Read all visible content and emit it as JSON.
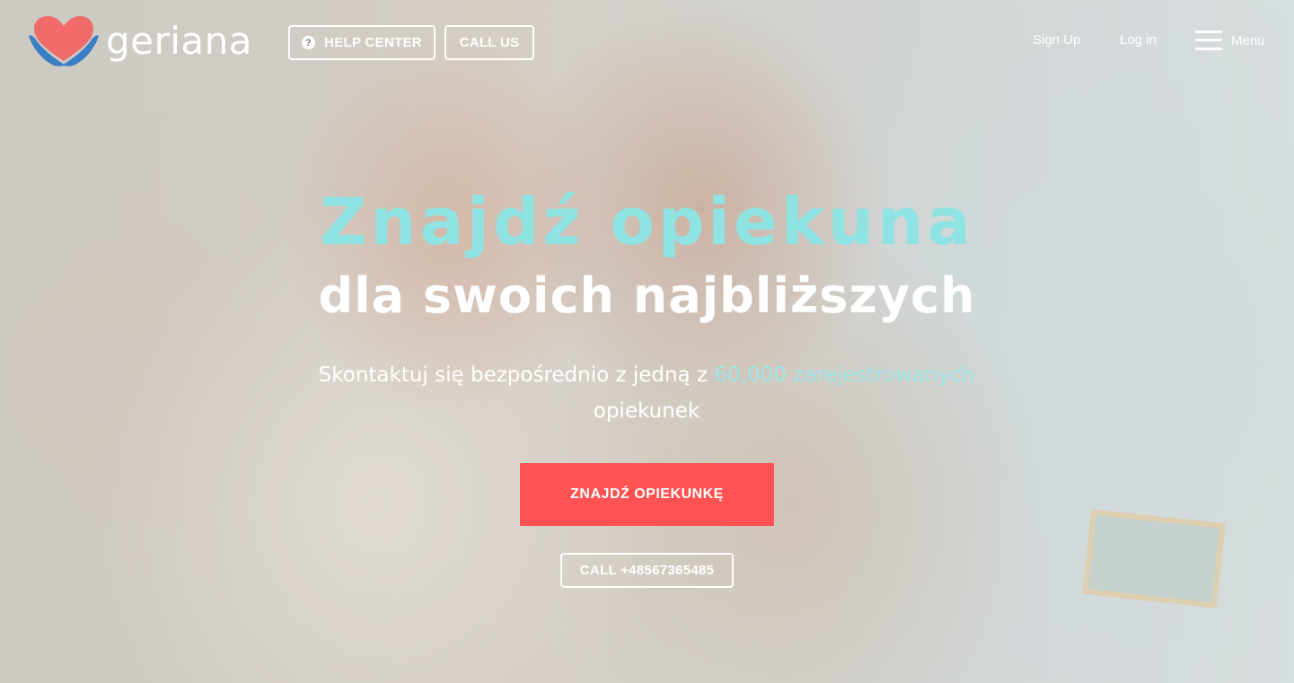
{
  "brand": {
    "name": "geriana",
    "heart_color": "#f26b6b",
    "hands_color": "#3a7fc4"
  },
  "header": {
    "help_center": "HELP CENTER",
    "call_us": "CALL US",
    "sign_up": "Sign Up",
    "log_in": "Log in",
    "menu": "Menu"
  },
  "hero": {
    "title_line1": "Znajdź opiekuna",
    "title_line2": "dla swoich najbliższych",
    "subtitle_prefix": "Skontaktuj się bezpośrednio z jedną z ",
    "subtitle_accent": "60,000 zarejestrowanych",
    "subtitle_suffix": "opiekunek",
    "cta_label": "ZNAJDŹ OPIEKUNKĘ",
    "call_label": "CALL +48567365485"
  },
  "colors": {
    "accent": "#8fe3e3",
    "cta": "#ff5252"
  },
  "icons": {
    "help": "question-circle-icon",
    "menu": "hamburger-icon",
    "logo": "heart-hands-icon"
  }
}
